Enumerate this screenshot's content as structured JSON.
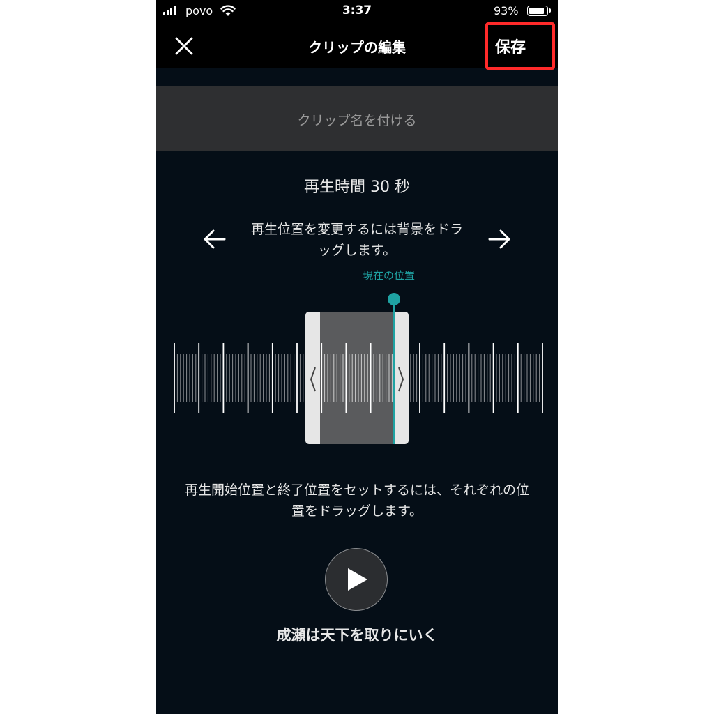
{
  "status_bar": {
    "carrier": "povo",
    "time": "3:37",
    "battery": "93%",
    "battery_level": 0.93
  },
  "nav": {
    "title": "クリップの編集",
    "save_label": "保存"
  },
  "clip_name": {
    "placeholder": "クリップ名を付ける"
  },
  "duration_text": "再生時間 30 秒",
  "instruction_top": "再生位置を変更するには背景をドラッグします。",
  "current_position_label": "現在の位置",
  "instruction_bottom": "再生開始位置と終了位置をセットするには、それぞれの位置をドラッグします。",
  "episode_title": "成瀬は天下を取りにいく",
  "colors": {
    "background": "#050e17",
    "accent": "#1fa3a3",
    "save_highlight": "#ff2a2a"
  },
  "icons": {
    "close": "close-icon",
    "arrow_left": "arrow-left-icon",
    "arrow_right": "arrow-right-icon",
    "play": "play-icon",
    "wifi": "wifi-icon",
    "signal": "signal-icon",
    "battery": "battery-icon"
  }
}
